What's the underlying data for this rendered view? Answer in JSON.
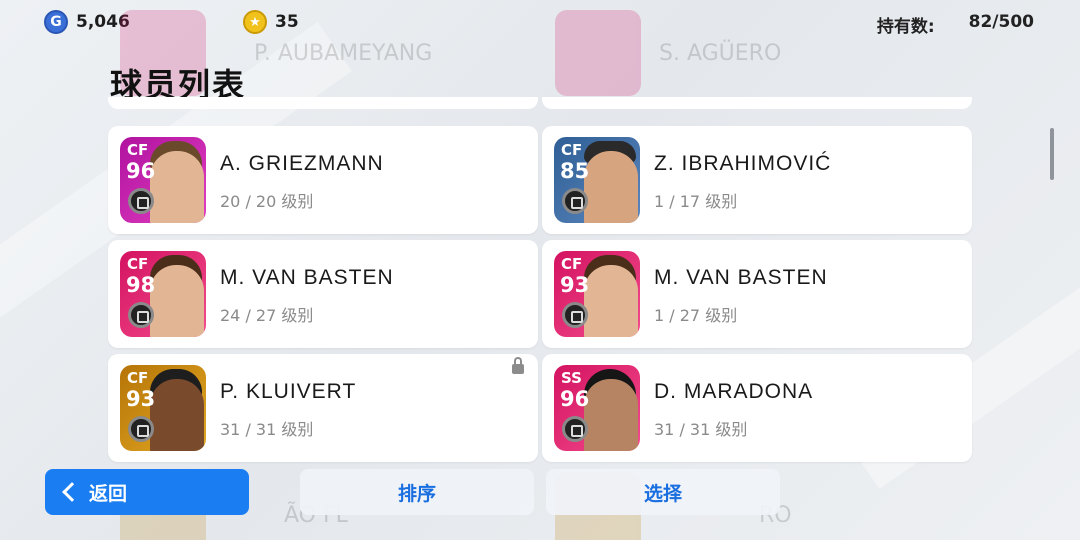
{
  "header": {
    "gp_value": "5,046",
    "gp_icon": "gp-coin-icon",
    "coin_value": "35",
    "coin_icon": "star-coin-icon",
    "holding_label": "持有数:",
    "holding_value": "82/500"
  },
  "page_title": "球员列表",
  "ghost_top": [
    {
      "name": "P. AUBAMEYANG"
    },
    {
      "name": "S. AGÜERO"
    }
  ],
  "ghost_bottom": [
    {
      "name": "ÃO FL"
    },
    {
      "name": "RO"
    }
  ],
  "players": [
    {
      "name": "A. GRIEZMANN",
      "level": "20 / 20 级别",
      "position": "CF",
      "rating": "96",
      "card_color": "#b0129f",
      "card_color2": "#e23fc1",
      "locked": false
    },
    {
      "name": "Z. IBRAHIMOVIĆ",
      "level": "1 / 17 级别",
      "position": "CF",
      "rating": "85",
      "card_color": "#2f5f96",
      "card_color2": "#5a86bd",
      "locked": false
    },
    {
      "name": "M. VAN BASTEN",
      "level": "24 / 27 级别",
      "position": "CF",
      "rating": "98",
      "card_color": "#d41361",
      "card_color2": "#f34c8c",
      "locked": false
    },
    {
      "name": "M. VAN BASTEN",
      "level": "1 / 27 级别",
      "position": "CF",
      "rating": "93",
      "card_color": "#d41361",
      "card_color2": "#f34c8c",
      "locked": false
    },
    {
      "name": "P. KLUIVERT",
      "level": "31 / 31 级别",
      "position": "CF",
      "rating": "93",
      "card_color": "#b67407",
      "card_color2": "#e2a923",
      "locked": true
    },
    {
      "name": "D. MARADONA",
      "level": "31 / 31 级别",
      "position": "SS",
      "rating": "96",
      "card_color": "#d41361",
      "card_color2": "#f34c8c",
      "locked": false
    }
  ],
  "buttons": {
    "back_label": "返回",
    "sort_label": "排序",
    "select_label": "选择"
  }
}
